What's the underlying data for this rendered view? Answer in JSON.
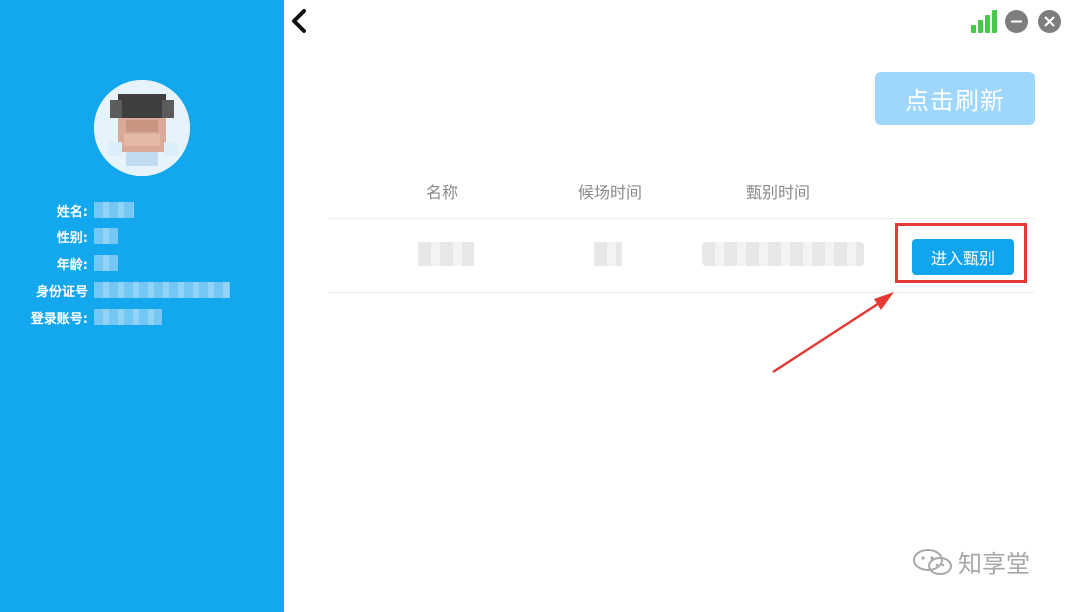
{
  "sidebar": {
    "accent_color": "#13a7ee",
    "profile": {
      "avatar": "avatar",
      "fields": [
        {
          "label": "姓名:"
        },
        {
          "label": "性别:"
        },
        {
          "label": "年龄:"
        },
        {
          "label": "身份证号"
        },
        {
          "label": "登录账号:"
        }
      ]
    }
  },
  "header": {
    "back_icon": "chevron-left-icon",
    "signal_icon": "signal-bars-icon",
    "minimize_icon": "minus-icon",
    "close_icon": "close-icon"
  },
  "main": {
    "refresh_button": "点击刷新",
    "table": {
      "headers": [
        "名称",
        "候场时间",
        "甄别时间"
      ],
      "rows": [
        {
          "action_label": "进入甄别"
        }
      ]
    },
    "highlight_color": "#e53935",
    "watermark": "知享堂"
  }
}
